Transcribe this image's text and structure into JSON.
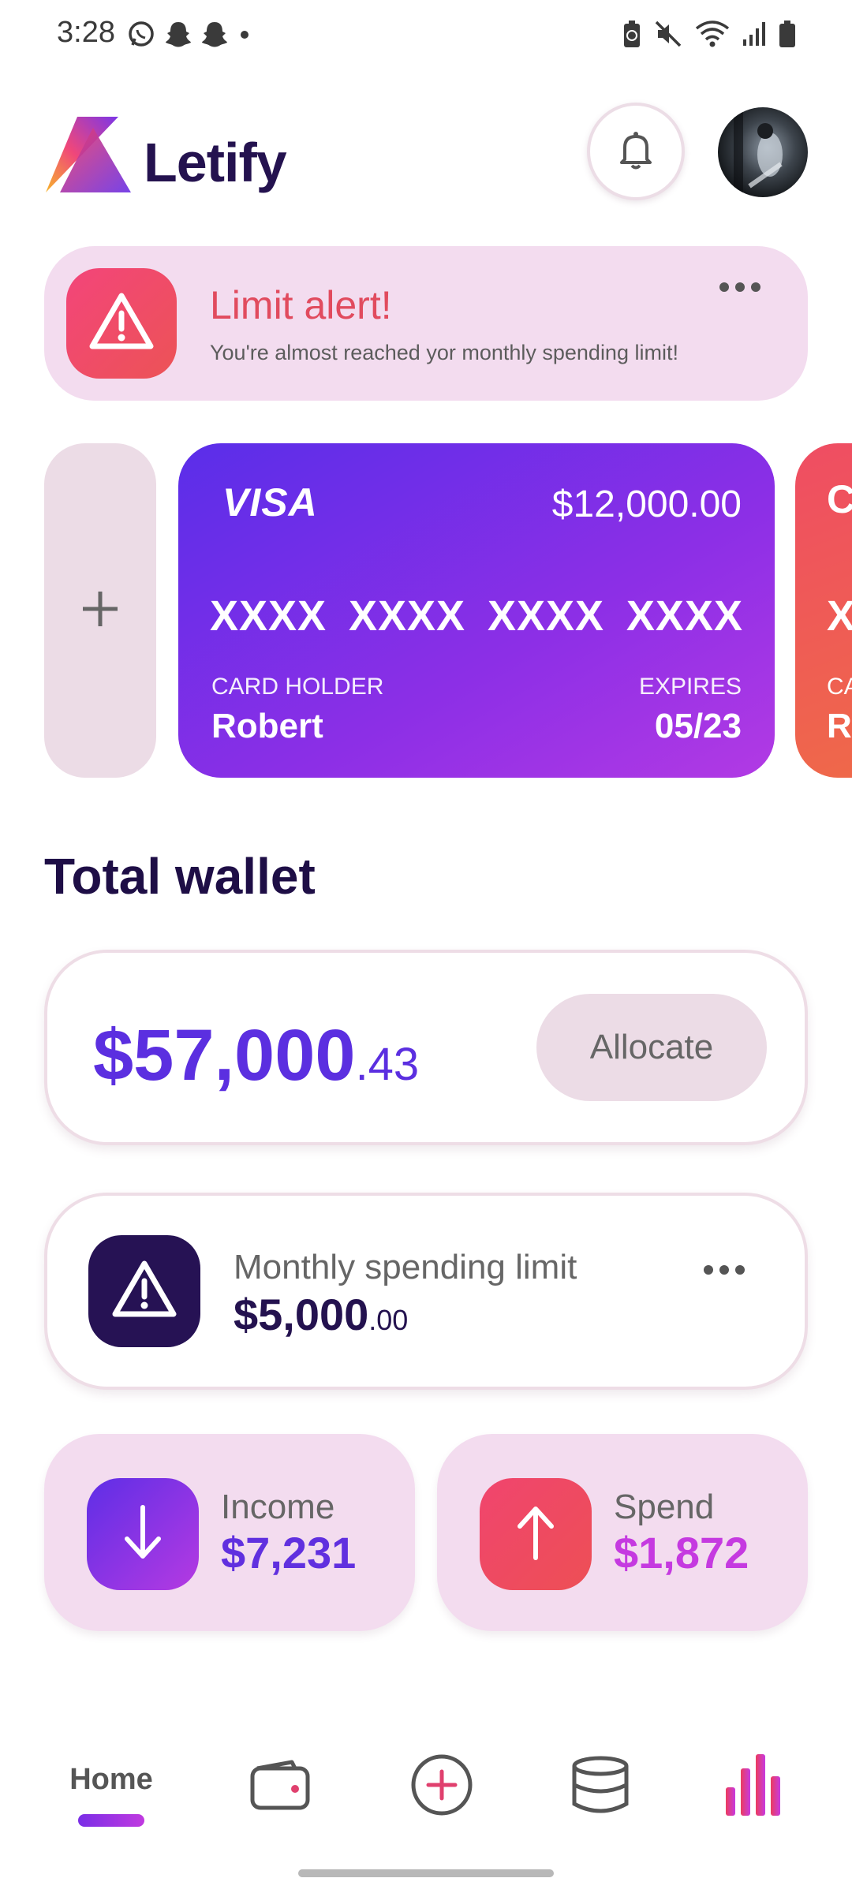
{
  "status_bar": {
    "time": "3:28",
    "left_icons": [
      "whatsapp-icon",
      "snapchat-icon",
      "snapchat-icon",
      "dot-icon"
    ],
    "right_icons": [
      "battery-saver-icon",
      "mute-icon",
      "wifi-icon",
      "signal-icon",
      "battery-icon"
    ]
  },
  "header": {
    "brand": "Letify"
  },
  "alert": {
    "title": "Limit alert!",
    "message": "You're almost reached yor monthly spending limit!"
  },
  "card": {
    "network": "VISA",
    "balance": "$12,000.00",
    "number_groups": [
      "XXXX",
      "XXXX",
      "XXXX",
      "XXXX"
    ],
    "holder_label": "CARD HOLDER",
    "holder_name": "Robert",
    "expires_label": "EXPIRES",
    "expires_value": "05/23"
  },
  "wallet": {
    "section_title": "Total wallet",
    "amount_main": "$57,000",
    "amount_decimal": ".43",
    "allocate_label": "Allocate"
  },
  "limit": {
    "label": "Monthly spending limit",
    "amount_main": "$5,000",
    "amount_decimal": ".00"
  },
  "stats": {
    "income_label": "Income",
    "income_value": "$7,231",
    "spend_label": "Spend",
    "spend_value": "$1,872"
  },
  "nav": {
    "home_label": "Home",
    "items": [
      "home",
      "wallet-icon",
      "add-icon",
      "database-icon",
      "chart-icon"
    ]
  },
  "colors": {
    "accent_purple": "#5b2fe0",
    "accent_pink": "#c53ae0",
    "alert_red": "#e14b5e",
    "dark_navy": "#24124f",
    "soft_pink_bg": "#f3dcef"
  }
}
